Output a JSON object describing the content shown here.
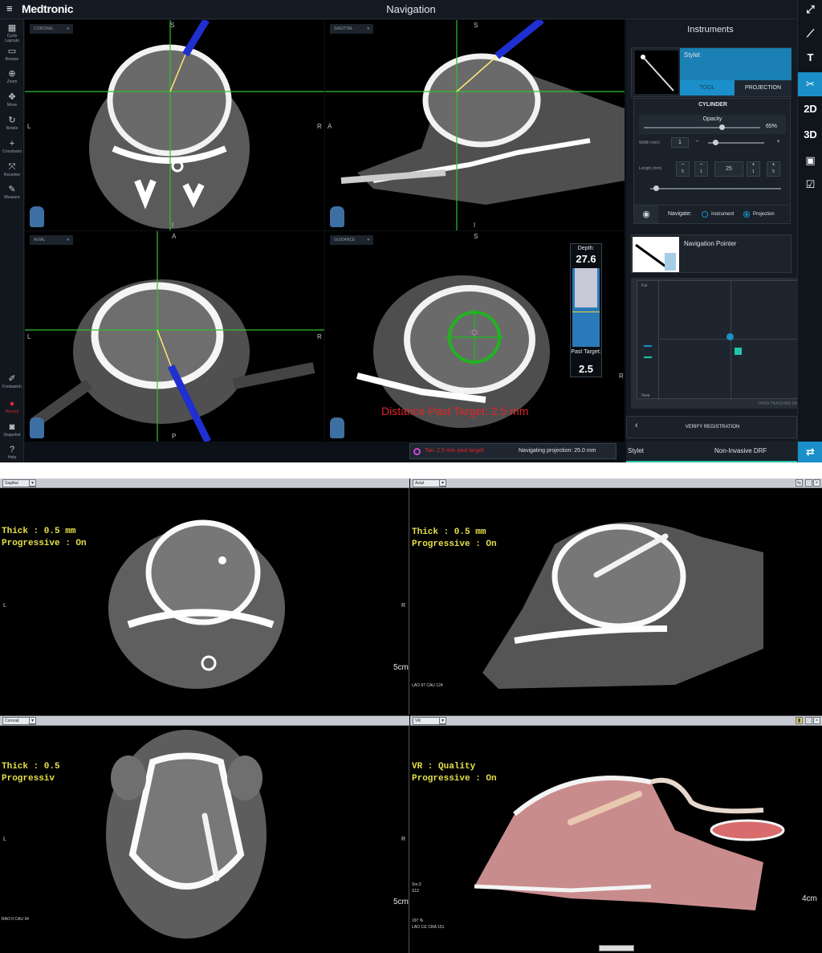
{
  "app": {
    "brand": "Medtronic",
    "title": "Navigation",
    "left_tools": [
      "Cycle Layouts",
      "Browse",
      "Zoom",
      "Move",
      "Rotate",
      "Crosshairs",
      "Recenter",
      "Measure"
    ],
    "bottom_tools": [
      "Footswitch",
      "Record",
      "Snapshot",
      "Help"
    ],
    "right_tools": [
      "T",
      "2D",
      "3D"
    ],
    "viewports": {
      "coronal": {
        "label": "CORONAL",
        "top": "S",
        "left": "L",
        "right": "R",
        "bottom": "I"
      },
      "sagittal": {
        "label": "SAGITTAL",
        "top": "S",
        "left": "A",
        "right": "P",
        "bottom": "I"
      },
      "axial": {
        "label": "AXIAL",
        "top": "A",
        "left": "L",
        "right": "R",
        "bottom": "P"
      },
      "guidance": {
        "label": "GUIDANCE",
        "top": "S",
        "right": "R"
      }
    },
    "depth": {
      "label": "Depth:",
      "value": "27.6",
      "past_label": "Past Target:",
      "past_value": "2.5",
      "fill_fraction": 0.5
    },
    "distance_past_target": "Distance Past Target: 2.5 mm",
    "status": {
      "past_target": "Tan: 2.5 mm past target",
      "navigating": "Navigating projection: 25.0 mm"
    },
    "instruments": {
      "header": "Instruments",
      "stylet": "Stylet",
      "tabs": [
        "TOOL",
        "PROJECTION"
      ],
      "cylinder": "CYLINDER",
      "opacity_label": "Opacity",
      "opacity_value": "65%",
      "opacity_fraction": 0.65,
      "width_label": "Width (mm)",
      "width_value": "1",
      "width_minus": "−",
      "width_plus": "+",
      "length_label": "Length (mm)",
      "length_value": "25",
      "length_buttons": [
        "5",
        "1",
        "1",
        "5"
      ],
      "navigate_label": "Navigate:",
      "navigate_options": [
        "Instrument",
        "Projection"
      ],
      "nav_pointer": "Navigation Pointer",
      "tracking_far": "Far",
      "tracking_near": "Near",
      "tracking_details": "OPEN TRACKING DETAILS",
      "verify": "VERIFY REGISTRATION",
      "bottom_left": "Stylet",
      "bottom_right": "Non-Invasive DRF"
    }
  },
  "viewer": {
    "panes": [
      {
        "name": "Sagittal",
        "line1": "Thick : 0.5 mm",
        "line2": "Progressive : On",
        "left": "L",
        "right": "R",
        "scale": "5cm"
      },
      {
        "name": "Axial",
        "line1": "Thick : 0.5 mm",
        "line2": "Progressive : On",
        "scale": "",
        "angle": "LAO 97 CAU 124"
      },
      {
        "name": "Coronal",
        "line1": "Thick : 0.5",
        "line2": "Progressiv",
        "left": "L",
        "right": "R",
        "scale": "5cm",
        "angle": "RAO 0 CAU 34"
      },
      {
        "name": "VR",
        "line1": "VR : Quality",
        "line2": "Progressive : On",
        "scale": "4cm",
        "info1": "Srs:3",
        "info2": "S12",
        "info3": "197 %",
        "info4": "LAO 111 CRA 151"
      }
    ]
  },
  "colors": {
    "accent": "#1a8fc9",
    "crosshair": "#2fc12f",
    "stylet": "#1f2fd0",
    "warning": "#e0262a",
    "overlay_text": "#e6e04a"
  }
}
